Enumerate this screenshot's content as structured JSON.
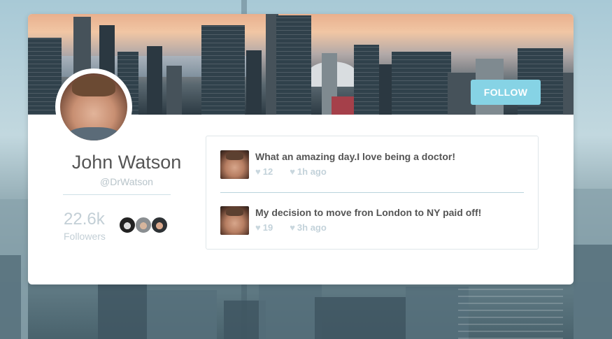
{
  "profile": {
    "name": "John Watson",
    "handle": "@DrWatson",
    "followers_count": "22.6k",
    "followers_label": "Followers",
    "follow_label": "FOLLOW"
  },
  "feed": {
    "posts": [
      {
        "text": "What an amazing day.I love being a doctor!",
        "likes": "12",
        "time": "1h ago"
      },
      {
        "text": "My decision to move fron London to NY paid off!",
        "likes": "19",
        "time": "3h ago"
      }
    ]
  },
  "icons": {
    "like": "heart-icon",
    "time": "heart-icon"
  },
  "colors": {
    "follow_button": "#86d3e5",
    "name_text": "#555555",
    "muted_text": "#c3cfd6"
  }
}
